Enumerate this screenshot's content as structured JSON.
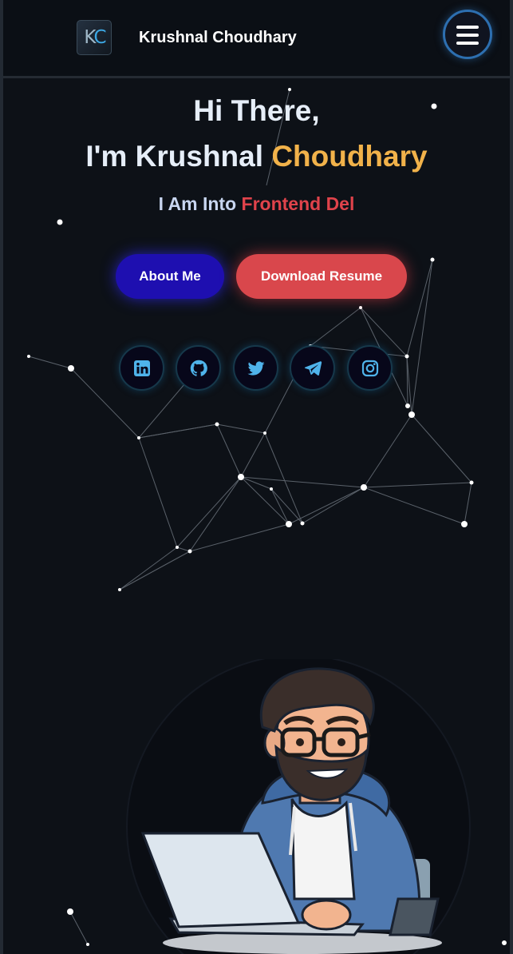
{
  "header": {
    "logo_text_k": "K",
    "logo_text_c": "C",
    "brand_name": "Krushnal Choudhary"
  },
  "hero": {
    "greeting": "Hi There,",
    "intro_prefix": "I'm Krushnal ",
    "intro_accent": "Choudhary",
    "typing_prefix": "I Am Into ",
    "typing_text": "Frontend Del"
  },
  "actions": {
    "about_label": "About Me",
    "resume_label": "Download Resume"
  },
  "social": [
    "linkedin-icon",
    "github-icon",
    "twitter-icon",
    "telegram-icon",
    "instagram-icon"
  ],
  "colors": {
    "background": "#0d1117",
    "accent_gold": "#f1b24a",
    "accent_red": "#e0434b",
    "about_button": "#1e0fb0",
    "resume_button": "#d9474c",
    "social_icon": "#4fb3ea"
  }
}
